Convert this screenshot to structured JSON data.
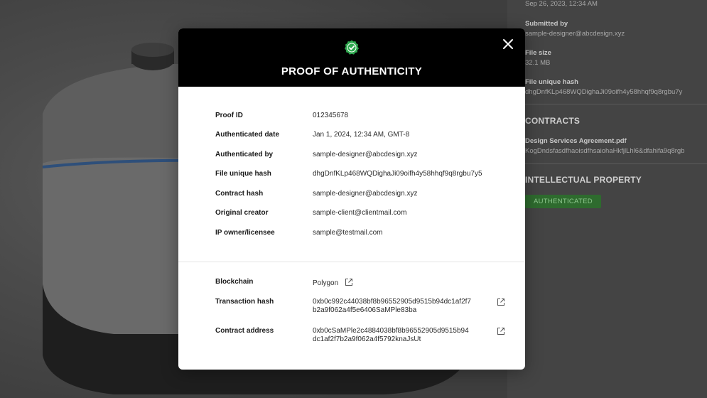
{
  "sidebar": {
    "date_value": "Sep 26, 2023, 12:34 AM",
    "submitted_by_label": "Submitted by",
    "submitted_by_value": "sample-designer@abcdesign.xyz",
    "file_size_label": "File size",
    "file_size_value": "32.1 MB",
    "file_hash_label": "File unique hash",
    "file_hash_value": "dhgDnfKLp468WQDighaJi09oifh4y58hhqf9q8rgbu7y",
    "contracts_title": "CONTRACTS",
    "contract_file": "Design Services Agreement.pdf",
    "contract_hash": "KogDndsfasdfhaoisdfhsaiohaHkfjlLhl6&dfahifa9q8rgb",
    "ip_title": "INTELLECTUAL PROPERTY",
    "ip_badge": "AUTHENTICATED"
  },
  "modal": {
    "title": "PROOF OF AUTHENTICITY",
    "details": [
      {
        "label": "Proof ID",
        "value": "012345678"
      },
      {
        "label": "Authenticated date",
        "value": "Jan 1, 2024, 12:34 AM, GMT-8"
      },
      {
        "label": "Authenticated by",
        "value": "sample-designer@abcdesign.xyz"
      },
      {
        "label": "File unique hash",
        "value": "dhgDnfKLp468WQDighaJi09oifh4y58hhqf9q8rgbu7y5"
      },
      {
        "label": "Contract hash",
        "value": "sample-designer@abcdesign.xyz"
      },
      {
        "label": "Original creator",
        "value": "sample-client@clientmail.com"
      },
      {
        "label": "IP owner/licensee",
        "value": "sample@testmail.com"
      }
    ],
    "chain": {
      "blockchain_label": "Blockchain",
      "blockchain_value": "Polygon",
      "tx_label": "Transaction hash",
      "tx_value_line1": "0xb0c992c44038bf8b96552905d9515b94dc1af2f7",
      "tx_value_line2": "b2a9f062a4f5e6406SaMPle83ba",
      "contract_label": "Contract address",
      "contract_value_line1": "0xb0cSaMPle2c4884038bf8b96552905d9515b94",
      "contract_value_line2": "dc1af2f7b2a9f062a4f5792knaJsUt"
    }
  },
  "colors": {
    "success": "#2fa84f",
    "header_bg": "#000000",
    "badge_bg": "#2e6b2e"
  }
}
